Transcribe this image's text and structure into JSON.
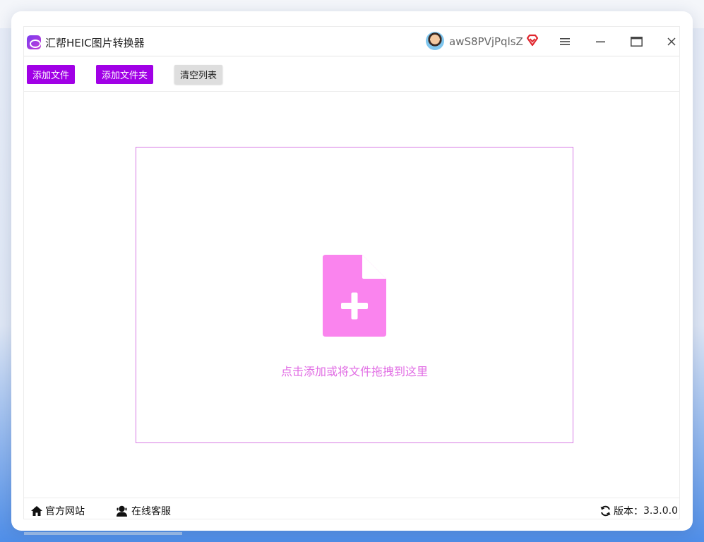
{
  "app": {
    "title": "汇帮HEIC图片转换器"
  },
  "user": {
    "name": "awS8PVjPqlsZ",
    "vip_icon": "vip-diamond-icon"
  },
  "window_controls": {
    "menu": "≡",
    "minimize": "—",
    "maximize": "▭",
    "close": "✕"
  },
  "toolbar": {
    "add_file_label": "添加文件",
    "add_folder_label": "添加文件夹",
    "clear_list_label": "清空列表"
  },
  "dropzone": {
    "hint": "点击添加或将文件拖拽到这里",
    "icon": "file-add-icon"
  },
  "statusbar": {
    "website_label": "官方网站",
    "support_label": "在线客服",
    "version_label": "版本：",
    "version_value": "3.3.0.0"
  },
  "colors": {
    "accent": "#a100e6",
    "dropzone_border": "#d77be4",
    "file_icon": "#fa84ee",
    "hint_text": "#e16de4"
  }
}
